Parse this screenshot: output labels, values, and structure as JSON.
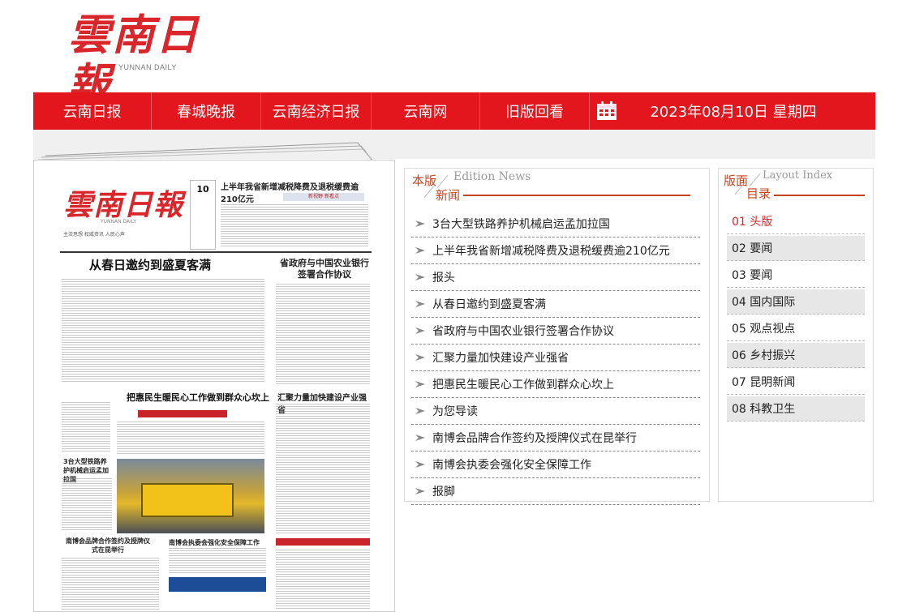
{
  "logo": {
    "cn": "雲南日報",
    "en": "YUNNAN DAILY"
  },
  "nav": {
    "items": [
      "云南日报",
      "春城晚报",
      "云南经济日报",
      "云南网",
      "旧版回看"
    ],
    "calendar_icon": "calendar-icon",
    "date": "2023年08月10日 星期四"
  },
  "paper": {
    "logo": "雲南日報",
    "logo_en": "YUNNAN DAILY",
    "tagline": "主流思想  权威资讯  人民心声",
    "date_num": "10",
    "top_headline": "上半年我省新增减税降费及退税缓费逾210亿元",
    "red_label": "新视野   新看点",
    "headline1": "从春日邀约到盛夏客满",
    "headline1b": "省政府与中国农业银行签署合作协议",
    "headline2": "把惠民生暖民心工作做到群众心坎上",
    "headline2b": "汇聚力量加快建设产业强省",
    "headline3": "3台大型铁路养护机械启运孟加拉国",
    "headline4": "南博会品牌合作签约及授牌仪式在昆举行",
    "headline4b": "南博会执委会强化安全保障工作"
  },
  "edition": {
    "title_cn_1": "本版",
    "title_cn_2": "新闻",
    "title_en": "Edition News",
    "items": [
      "3台大型铁路养护机械启运孟加拉国",
      "上半年我省新增减税降费及退税缓费逾210亿元",
      "报头",
      "从春日邀约到盛夏客满",
      "省政府与中国农业银行签署合作协议",
      "汇聚力量加快建设产业强省",
      "把惠民生暖民心工作做到群众心坎上",
      "为您导读",
      "南博会品牌合作签约及授牌仪式在昆举行",
      "南博会执委会强化安全保障工作",
      "报脚"
    ]
  },
  "layout": {
    "title_cn_1": "版面",
    "title_cn_2": "目录",
    "title_en": "Layout Index",
    "items": [
      "01 头版",
      "02 要闻",
      "03 要闻",
      "04 国内国际",
      "05 观点视点",
      "06 乡村振兴",
      "07 昆明新闻",
      "08 科教卫生"
    ]
  },
  "colors": {
    "brand_red": "#e3151d",
    "accent_orange": "#c4441f"
  }
}
